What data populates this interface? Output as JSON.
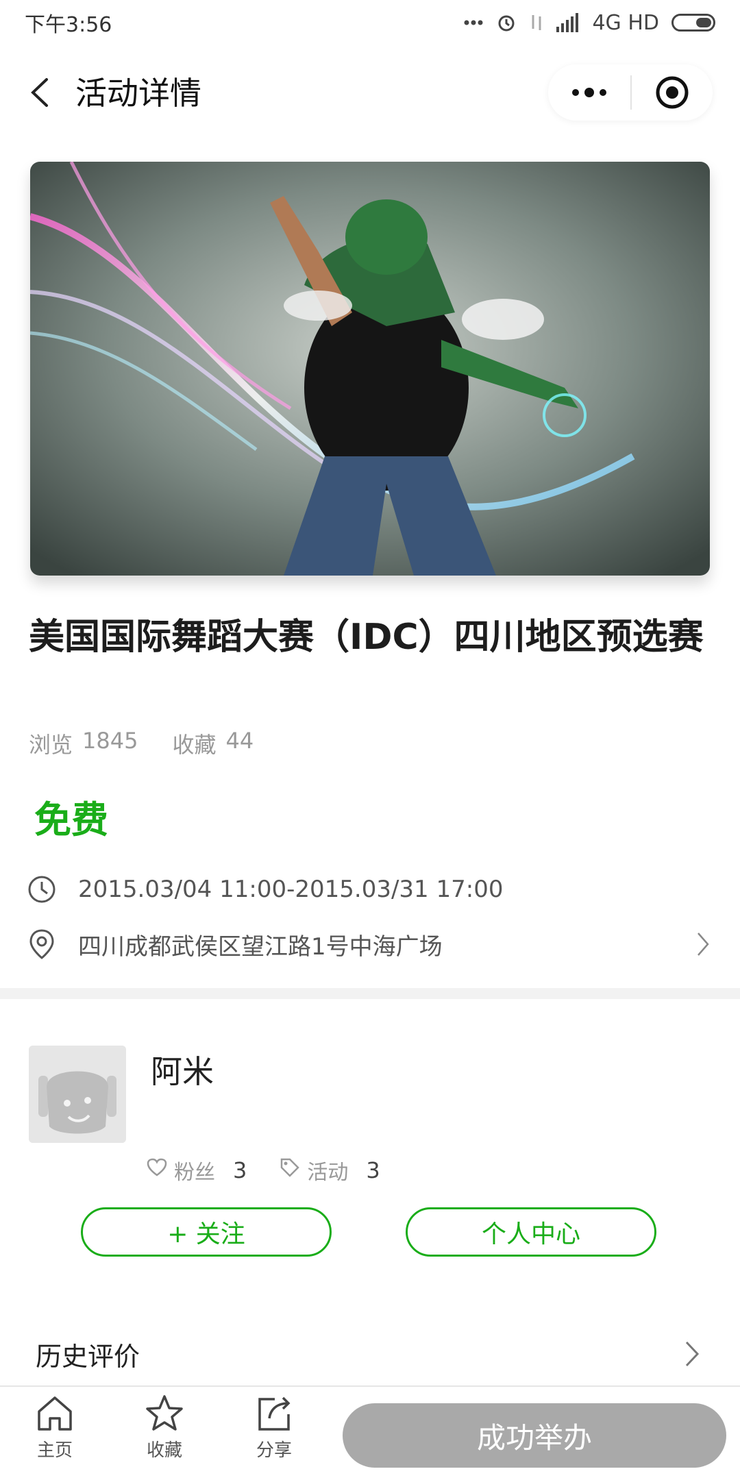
{
  "status_bar": {
    "time": "下午3:56",
    "network": "4G HD"
  },
  "nav": {
    "title": "活动详情"
  },
  "event": {
    "title": "美国国际舞蹈大赛（IDC）四川地区预选赛",
    "views_label": "浏览",
    "views": "1845",
    "favorites_label": "收藏",
    "favorites": "44",
    "price": "免费",
    "time_range": "2015.03/04 11:00-2015.03/31 17:00",
    "address": "四川成都武侯区望江路1号中海广场"
  },
  "organizer": {
    "name": "阿米",
    "fans_label": "粉丝",
    "fans": "3",
    "activities_label": "活动",
    "activities": "3",
    "follow_button": "+ 关注",
    "profile_button": "个人中心"
  },
  "history": {
    "label": "历史评价"
  },
  "tab_bar": {
    "home": "主页",
    "favorite": "收藏",
    "share": "分享",
    "cta": "成功举办"
  },
  "colors": {
    "accent_green": "#1aad19",
    "cta_disabled": "#a9a9a9"
  }
}
